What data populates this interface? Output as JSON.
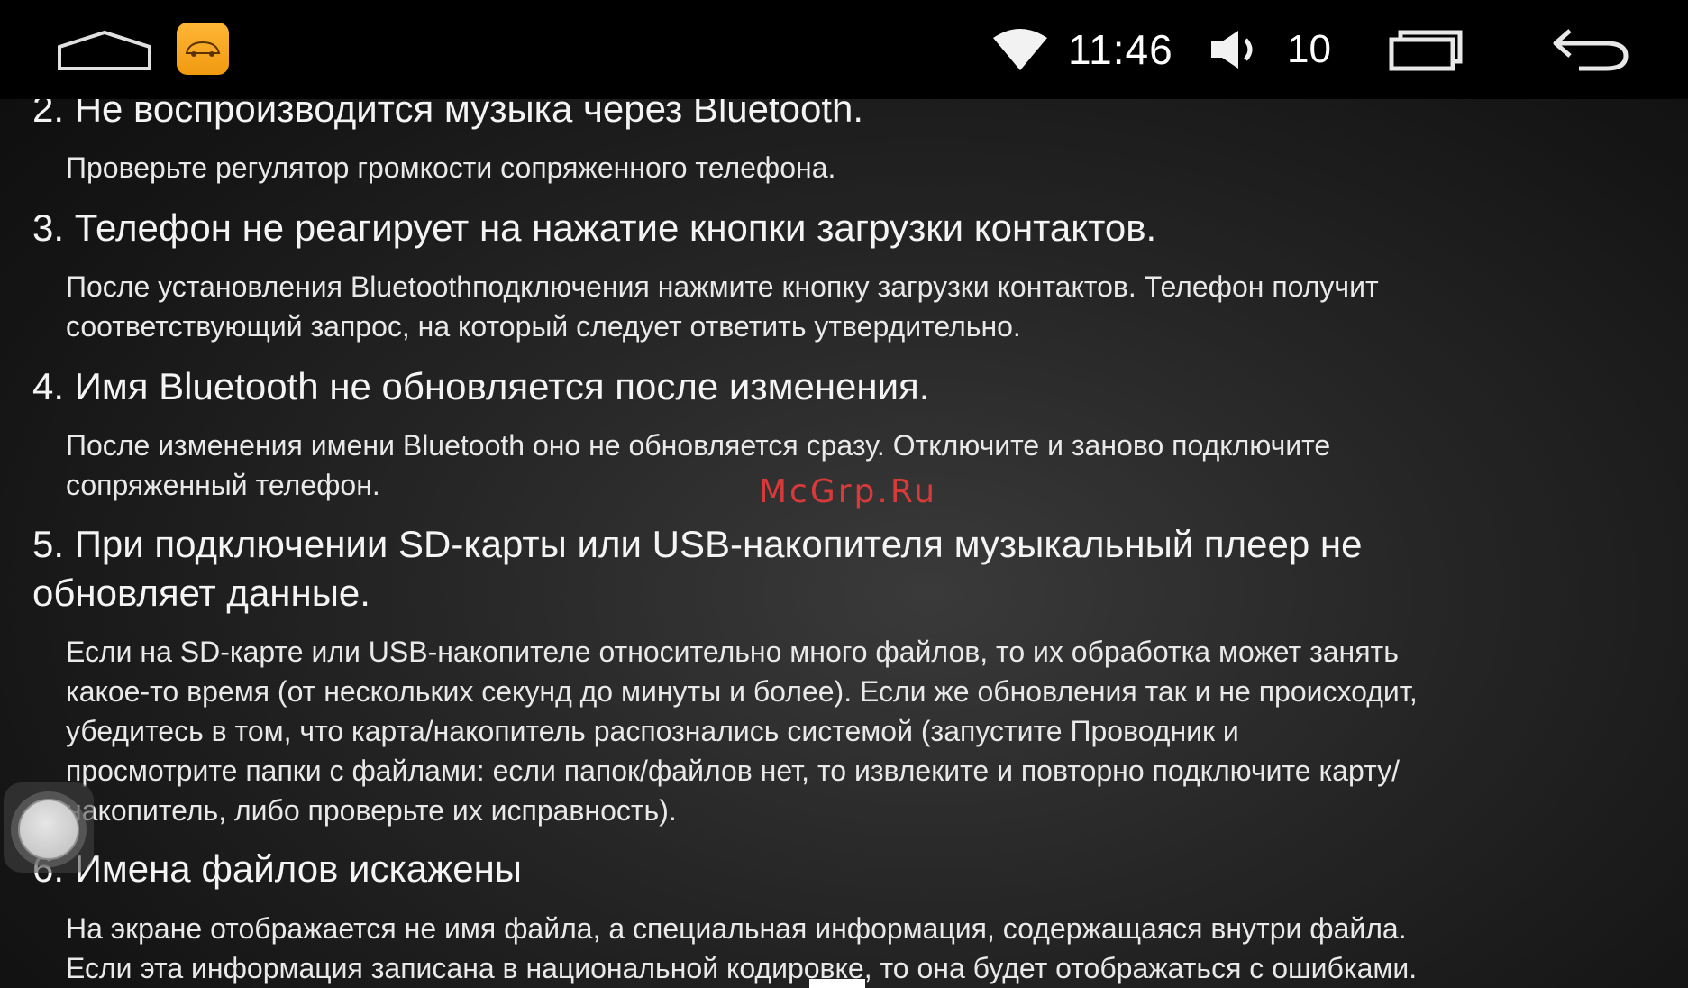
{
  "status_bar": {
    "time": "11:46",
    "volume_level": "10",
    "icons": [
      "home-icon",
      "app-icon",
      "wifi-icon",
      "speaker-icon",
      "recents-icon",
      "back-icon"
    ]
  },
  "sections": [
    {
      "question": "2. Не воспроизводится музыка через Bluetooth.",
      "answer_lines": [
        "Проверьте регулятор громкости сопряженного телефона."
      ]
    },
    {
      "question": "3. Телефон не реагирует на нажатие кнопки загрузки контактов.",
      "answer_lines": [
        "После установления Bluetoothподключения нажмите кнопку загрузки контактов. Телефон получит",
        "соответствующий запрос, на который следует ответить утвердительно."
      ]
    },
    {
      "question": "4. Имя Bluetooth не обновляется после изменения.",
      "answer_lines": [
        "После изменения имени Bluetooth оно не обновляется сразу. Отключите и заново подключите",
        "сопряженный телефон."
      ]
    },
    {
      "question_lines": [
        "5. При подключении SD-карты или USB-накопителя музыкальный плеер не",
        "обновляет данные."
      ],
      "answer_lines": [
        "Если на SD-карте или USB-накопителе относительно много файлов, то их обработка может занять",
        "какое-то время (от нескольких секунд до минуты и более). Если же обновления так и не происходит,",
        "убедитесь в том, что карта/накопитель распознались системой (запустите Проводник и",
        "просмотрите папки с файлами: если папок/файлов нет, то извлеките и повторно подключите карту/",
        "накопитель, либо проверьте их исправность)."
      ]
    },
    {
      "question": "6. Имена файлов искажены",
      "answer_lines": [
        "На экране отображается не имя файла, а специальная информация, содержащаяся внутри файла.",
        "Если эта информация записана в национальной кодировке, то она будет отображаться с ошибками."
      ]
    }
  ],
  "watermark": "McGrp.Ru",
  "colors": {
    "status_bar_bg": "#000000",
    "app_icon": "#f5a623",
    "watermark": "#d83a3a",
    "text": "#f4f4f4"
  }
}
